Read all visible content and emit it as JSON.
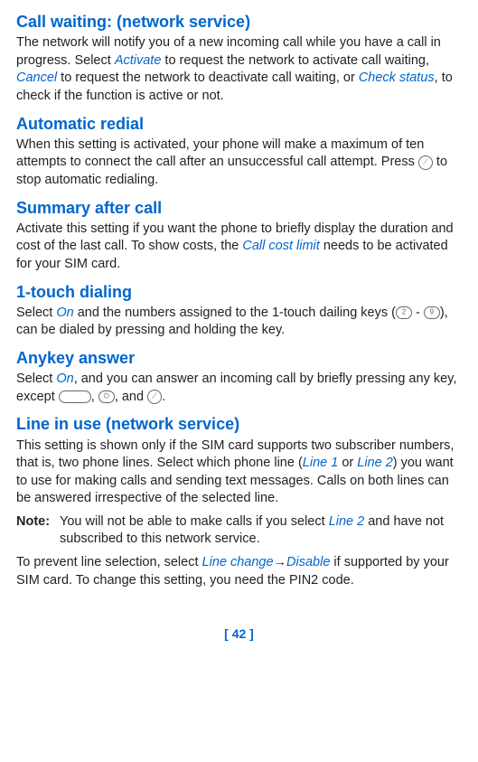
{
  "sections": {
    "call_waiting": {
      "heading": "Call waiting: (network service)",
      "text_1": "The network will notify you of a new incoming call while you have a call in progress. Select ",
      "link_1": "Activate",
      "text_2": " to request the network to activate call waiting, ",
      "link_2": "Cancel",
      "text_3": " to request the network to deactivate call waiting, or ",
      "link_3": "Check status",
      "text_4": ", to check if the function is active or not."
    },
    "automatic_redial": {
      "heading": "Automatic redial",
      "text_1": "When this setting is activated, your phone will make a maximum of ten attempts to connect the call after an unsuccessful call attempt. Press ",
      "text_2": " to stop automatic redialing."
    },
    "summary_after_call": {
      "heading": "Summary after call",
      "text_1": "Activate this setting if you want the phone to briefly display the duration and cost of the last call. To show costs, the ",
      "link_1": "Call cost limit",
      "text_2": " needs to be activated for your SIM card."
    },
    "one_touch_dialing": {
      "heading": "1-touch dialing",
      "text_1": "Select ",
      "link_1": "On",
      "text_2": " and the numbers assigned to the 1-touch dailing keys (",
      "text_3": " - ",
      "text_4": "), can be dialed by pressing and holding the key."
    },
    "anykey_answer": {
      "heading": "Anykey answer",
      "text_1": "Select ",
      "link_1": "On",
      "text_2": ", and you can answer an incoming call by briefly pressing any key, except ",
      "text_3": ", ",
      "text_4": ", and ",
      "text_5": "."
    },
    "line_in_use": {
      "heading": "Line in use (network service)",
      "text_1": "This setting is shown only if the SIM card supports two subscriber numbers, that is, two phone lines. Select which phone line (",
      "link_1": "Line 1",
      "text_2": " or ",
      "link_2": "Line 2",
      "text_3": ") you want to use for making calls and sending text messages. Calls on both lines can be answered irrespective of the selected line.",
      "note_label": "Note:",
      "note_text_1": "You will not be able to make calls if you select ",
      "note_link_1": "Line 2",
      "note_text_2": " and have not subscribed to this network service.",
      "prevent_text_1": "To prevent line selection, select ",
      "prevent_link_1": "Line change",
      "prevent_arrow": "→",
      "prevent_link_2": "Disable",
      "prevent_text_2": " if supported by your SIM card. To change this setting, you need the PIN2 code."
    }
  },
  "page_number": "[ 42 ]",
  "key_labels": {
    "key_2": "2",
    "key_9": "9"
  }
}
